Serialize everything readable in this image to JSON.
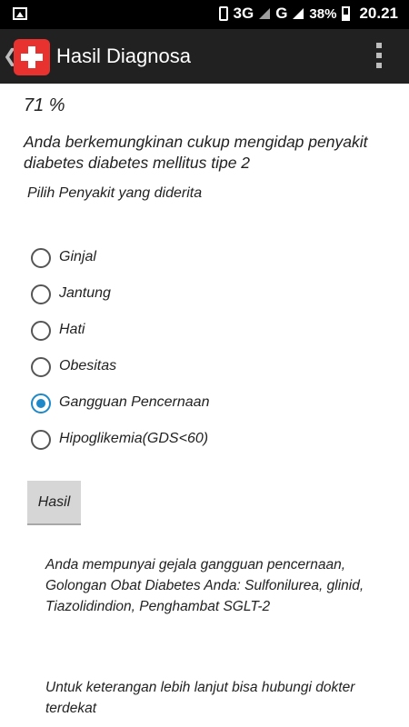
{
  "status_bar": {
    "network_3g": "3G",
    "network_g": "G",
    "battery": "38%",
    "time": "20.21",
    "icons": [
      "image-icon",
      "vibrate-icon",
      "signal-icon",
      "battery-icon"
    ]
  },
  "app_bar": {
    "title": "Hasil Diagnosa",
    "icons": [
      "back-chevron-icon",
      "app-logo-icon",
      "overflow-menu-icon"
    ],
    "logo_color": "#e8322f",
    "background": "#212121"
  },
  "main": {
    "percent": "71 %",
    "result_text": "Anda berkemungkinan cukup mengidap penyakit diabetes diabetes mellitus tipe 2",
    "choose_label": "Pilih Penyakit yang diderita",
    "options": [
      {
        "label": "Ginjal",
        "selected": false
      },
      {
        "label": "Jantung",
        "selected": false
      },
      {
        "label": "Hati",
        "selected": false
      },
      {
        "label": "Obesitas",
        "selected": false
      },
      {
        "label": "Gangguan Pencernaan",
        "selected": true
      },
      {
        "label": "Hipoglikemia(GDS<60)",
        "selected": false
      }
    ],
    "button_label": "Hasil",
    "diagnosis_text": "Anda mempunyai gejala gangguan pencernaan, Golongan Obat Diabetes Anda: Sulfonilurea, glinid, Tiazolidindion, Penghambat SGLT-2",
    "info_text": "Untuk keterangan lebih lanjut bisa hubungi dokter terdekat",
    "accent_color": "#1e88c8"
  }
}
